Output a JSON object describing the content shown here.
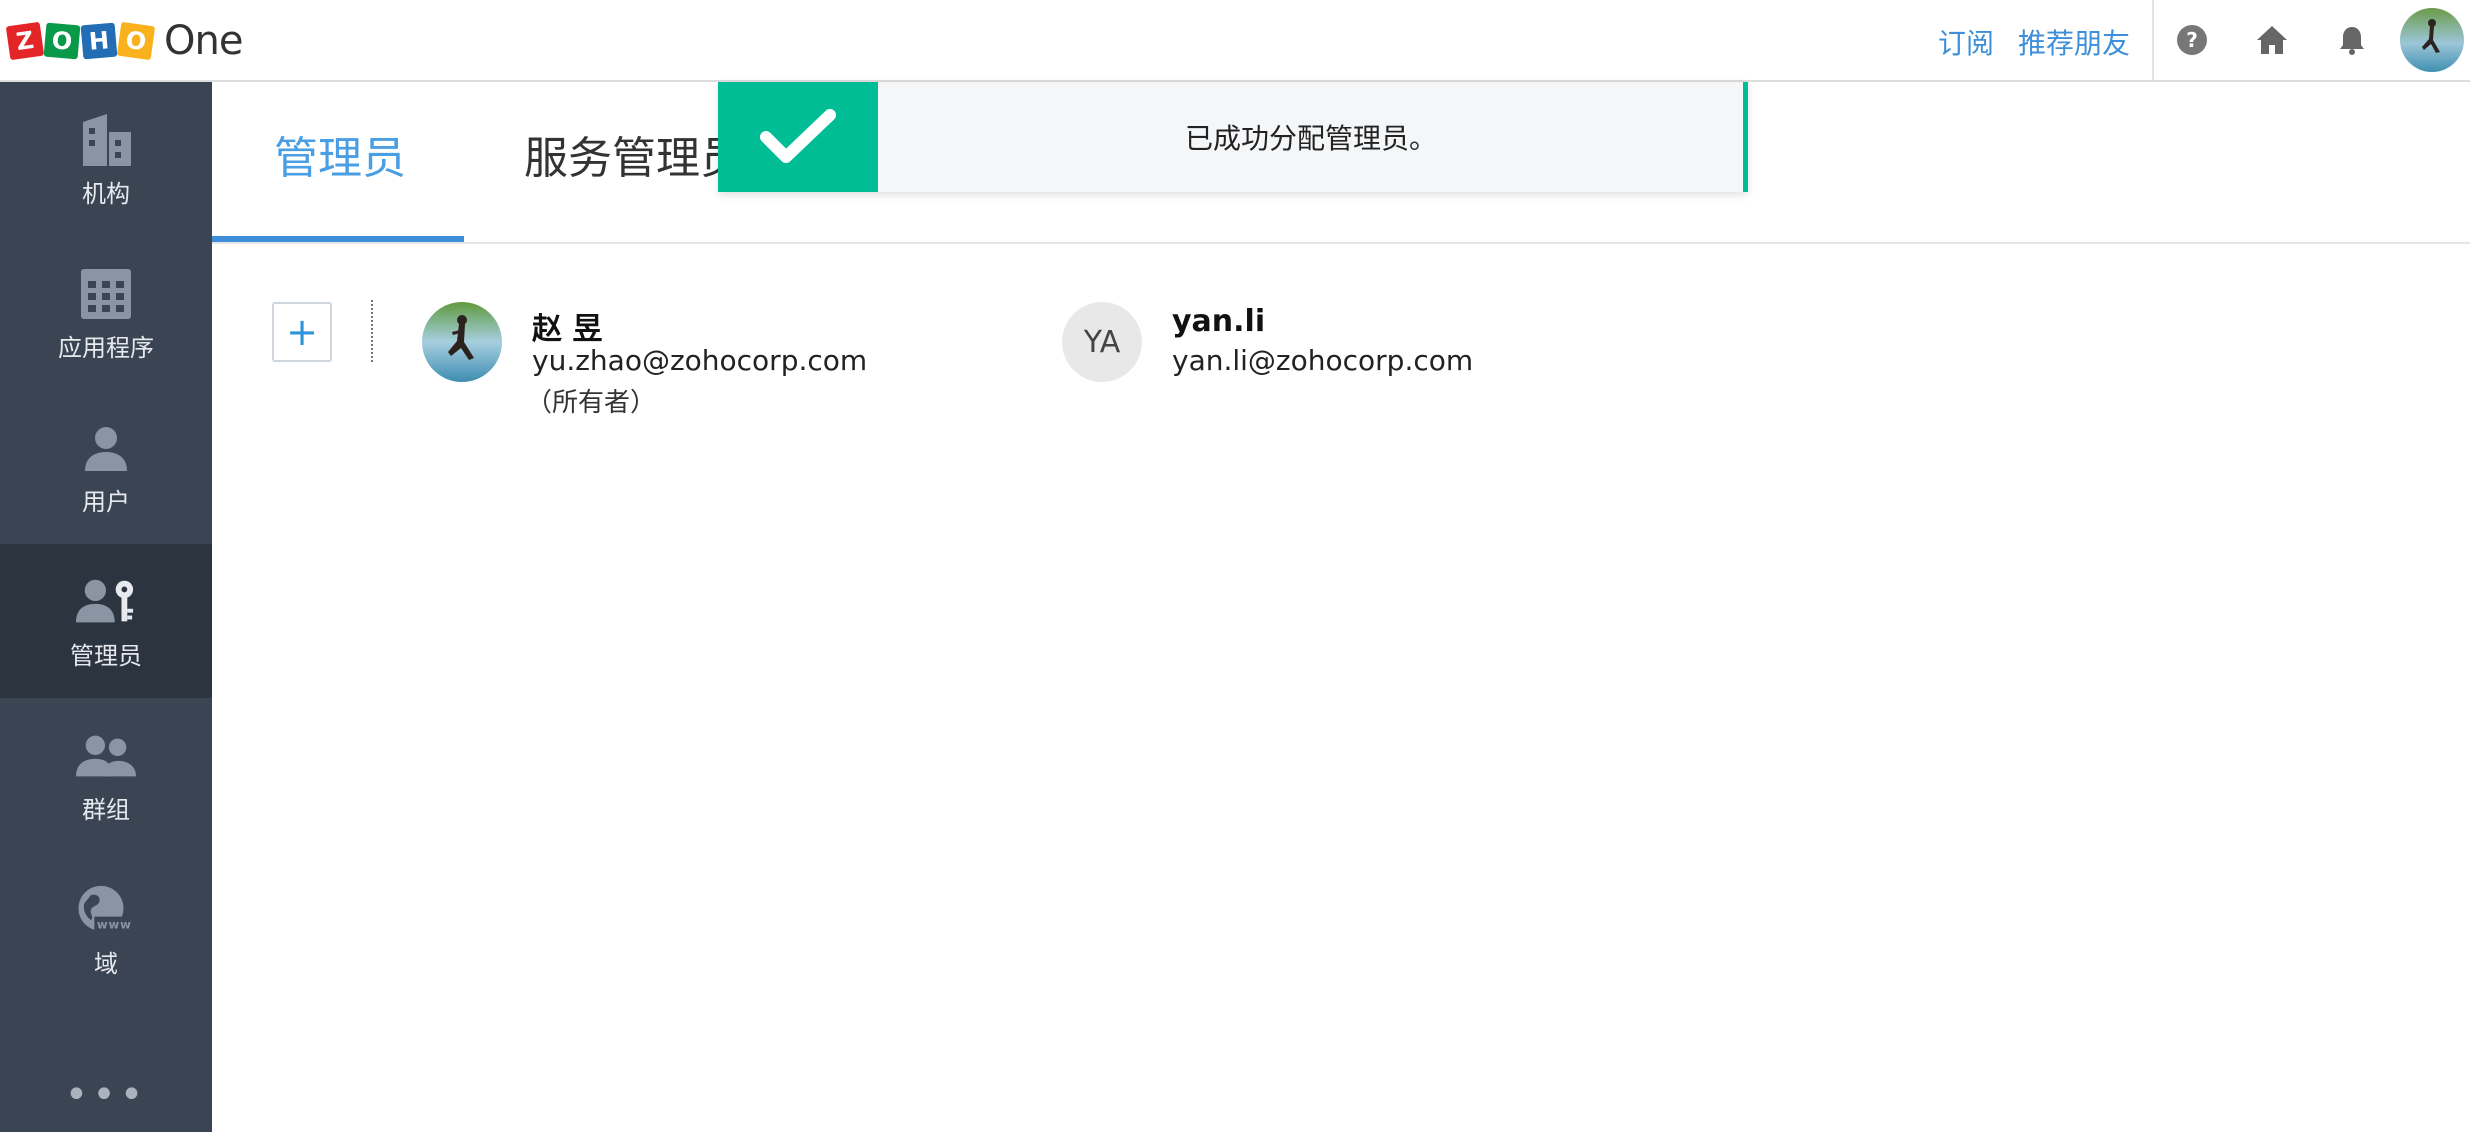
{
  "brand": {
    "logo_letters": [
      "Z",
      "O",
      "H",
      "O"
    ],
    "product": "One",
    "colors": [
      "#e42527",
      "#089949",
      "#226db4",
      "#f9b21d"
    ]
  },
  "header": {
    "links": [
      "订阅",
      "推荐朋友"
    ],
    "icons": [
      "help-icon",
      "home-icon",
      "bell-icon",
      "user-avatar"
    ],
    "accent": "#3d8fd9"
  },
  "sidebar": {
    "items": [
      {
        "label": "机构",
        "icon": "building-icon"
      },
      {
        "label": "应用程序",
        "icon": "apps-grid-icon"
      },
      {
        "label": "用户",
        "icon": "user-icon"
      },
      {
        "label": "管理员",
        "icon": "admin-key-icon",
        "active": true
      },
      {
        "label": "群组",
        "icon": "group-icon"
      },
      {
        "label": "域",
        "icon": "globe-www-icon"
      }
    ],
    "more": "•••"
  },
  "tabs": [
    {
      "label": "管理员",
      "active": true
    },
    {
      "label": "服务管理员",
      "active": false
    }
  ],
  "admins": [
    {
      "name": "赵 昱",
      "email": "yu.zhao@zohocorp.com",
      "role": "（所有者）",
      "avatar": "photo"
    },
    {
      "name": "yan.li",
      "email": "yan.li@zohocorp.com",
      "initials": "YA"
    }
  ],
  "add_button": "+",
  "toast": {
    "message": "已成功分配管理员。",
    "color": "#00bd95"
  }
}
